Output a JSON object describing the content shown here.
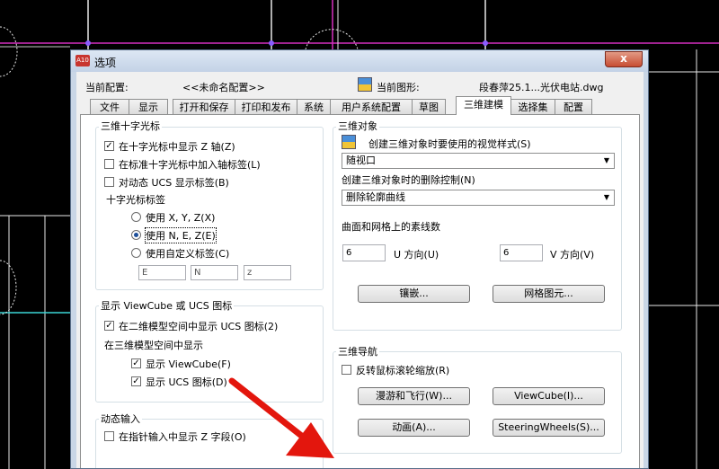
{
  "dialog": {
    "title": "选项",
    "app_icon": "A10",
    "close_label": "x",
    "current_config_label": "当前配置:",
    "current_config_value": "<<未命名配置>>",
    "current_drawing_label": "当前图形:",
    "current_drawing_value": "段春萍25.1...光伏电站.dwg",
    "tabs": [
      "文件",
      "显示",
      "打开和保存",
      "打印和发布",
      "系统",
      "用户系统配置",
      "草图",
      "三维建模",
      "选择集",
      "配置"
    ],
    "active_tab": "三维建模"
  },
  "crosshair": {
    "title": "三维十字光标",
    "show_z": "在十字光标中显示 Z 轴(Z)",
    "add_axis_label": "在标准十字光标中加入轴标签(L)",
    "dynamic_ucs_label": "对动态 UCS 显示标签(B)",
    "labels_title": "十字光标标签",
    "opt_xyz": "使用 X, Y, Z(X)",
    "opt_nez": "使用 N, E, Z(E)",
    "opt_custom": "使用自定义标签(C)",
    "field1": "E",
    "field2": "N",
    "field3": "z"
  },
  "viewcube": {
    "title": "显示 ViewCube 或 UCS 图标",
    "show_2d": "在二维模型空间中显示 UCS 图标(2)",
    "in_3d_title": "在三维模型空间中显示",
    "show_viewcube": "显示 ViewCube(F)",
    "show_ucs": "显示 UCS 图标(D)"
  },
  "dynamic_input": {
    "title": "动态输入",
    "show_z_field": "在指针输入中显示 Z 字段(O)"
  },
  "objects3d": {
    "title": "三维对象",
    "visual_style_label": "创建三维对象时要使用的视觉样式(S)",
    "visual_style_value": "随视口",
    "delete_label": "创建三维对象时的删除控制(N)",
    "delete_value": "删除轮廓曲线",
    "isolines_label": "曲面和网格上的素线数",
    "u_value": "6",
    "u_label": "U 方向(U)",
    "v_value": "6",
    "v_label": "V 方向(V)",
    "tessellation_btn": "镶嵌...",
    "mesh_btn": "网格图元..."
  },
  "nav3d": {
    "title": "三维导航",
    "reverse_wheel": "反转鼠标滚轮缩放(R)",
    "walk_fly_btn": "漫游和飞行(W)...",
    "viewcube_btn": "ViewCube(I)...",
    "animation_btn": "动画(A)...",
    "steering_btn": "SteeringWheels(S)..."
  },
  "colors": {
    "arrow": "#e3160d",
    "titlebar": "#c9d6e6"
  }
}
